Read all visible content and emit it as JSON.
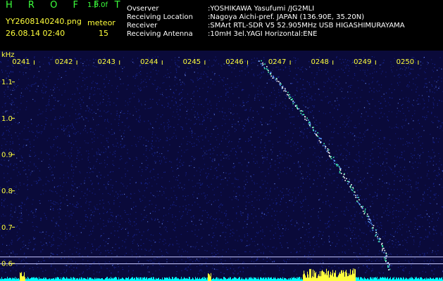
{
  "app": {
    "brand": "H R O F F T",
    "version": "1.0.0f"
  },
  "file": {
    "name": "YY2608140240.png",
    "datetime": "26.08.14 02:40",
    "category_label": "meteor",
    "count": "15"
  },
  "info": [
    {
      "label": "Ovserver",
      "value": ":YOSHIKAWA Yasufumi /JG2MLI"
    },
    {
      "label": "Receiving Location",
      "value": ":Nagoya Aichi-pref. JAPAN (136.90E, 35.20N)"
    },
    {
      "label": "Receiver",
      "value": ":SMArt RTL-SDR V5 52.905MHz USB HIGASHIMURAYAMA"
    },
    {
      "label": "Receiving Antenna",
      "value": ":10mH 3el.YAGI Horizontal:ENE"
    }
  ],
  "colors": {
    "background": "#0a0a3a",
    "noise": "#1a2aa0",
    "signal": "#3cffb0",
    "axis_text": "#ffff3c",
    "header_green": "#3cff3c",
    "baseline": "#00ffff"
  },
  "chart_data": {
    "type": "heatmap",
    "ylabel": "kHz",
    "x_ticks": [
      "0241",
      "0242",
      "0243",
      "0244",
      "0245",
      "0246",
      "0247",
      "0248",
      "0249",
      "0250"
    ],
    "y_ticks": [
      "1.1",
      "1.0",
      "0.9",
      "0.8",
      "0.7",
      "0.6"
    ],
    "ylim": [
      0.57,
      1.17
    ],
    "meteor_trace": [
      {
        "time": "02:46:10",
        "khz": 1.16
      },
      {
        "time": "02:46:45",
        "khz": 1.08
      },
      {
        "time": "02:47:20",
        "khz": 0.99
      },
      {
        "time": "02:47:50",
        "khz": 0.9
      },
      {
        "time": "02:48:20",
        "khz": 0.81
      },
      {
        "time": "02:48:45",
        "khz": 0.72
      },
      {
        "time": "02:49:05",
        "khz": 0.64
      },
      {
        "time": "02:49:15",
        "khz": 0.58
      }
    ],
    "reference_lines_khz": [
      0.617,
      0.598
    ],
    "grid": false
  }
}
